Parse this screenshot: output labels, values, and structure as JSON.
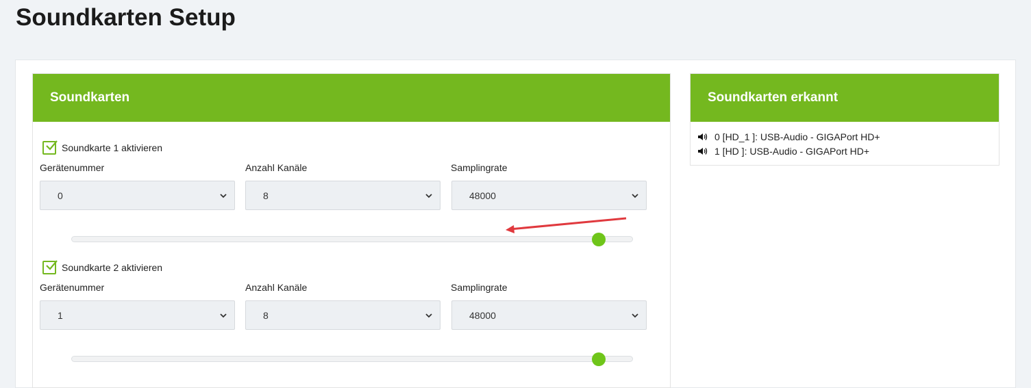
{
  "page": {
    "title": "Soundkarten Setup"
  },
  "main_card": {
    "title": "Soundkarten",
    "cards": [
      {
        "enable_label": "Soundkarte 1 aktivieren",
        "enabled": true,
        "device_label": "Gerätenummer",
        "device_value": "0",
        "channels_label": "Anzahl Kanäle",
        "channels_value": "8",
        "sampling_label": "Samplingrate",
        "sampling_value": "48000",
        "slider_level": 0.95
      },
      {
        "enable_label": "Soundkarte 2 aktivieren",
        "enabled": true,
        "device_label": "Gerätenummer",
        "device_value": "1",
        "channels_label": "Anzahl Kanäle",
        "channels_value": "8",
        "sampling_label": "Samplingrate",
        "sampling_value": "48000",
        "slider_level": 0.95
      }
    ]
  },
  "detected_card": {
    "title": "Soundkarten erkannt",
    "items": [
      {
        "text": "0 [HD_1 ]: USB-Audio - GIGAPort HD+",
        "icon": "speaker-icon"
      },
      {
        "text": "1 [HD ]: USB-Audio - GIGAPort HD+",
        "icon": "speaker-icon"
      }
    ]
  },
  "colors": {
    "accent": "#74b81f",
    "thumb": "#6fc51a",
    "annotation_arrow": "#e0393e"
  }
}
